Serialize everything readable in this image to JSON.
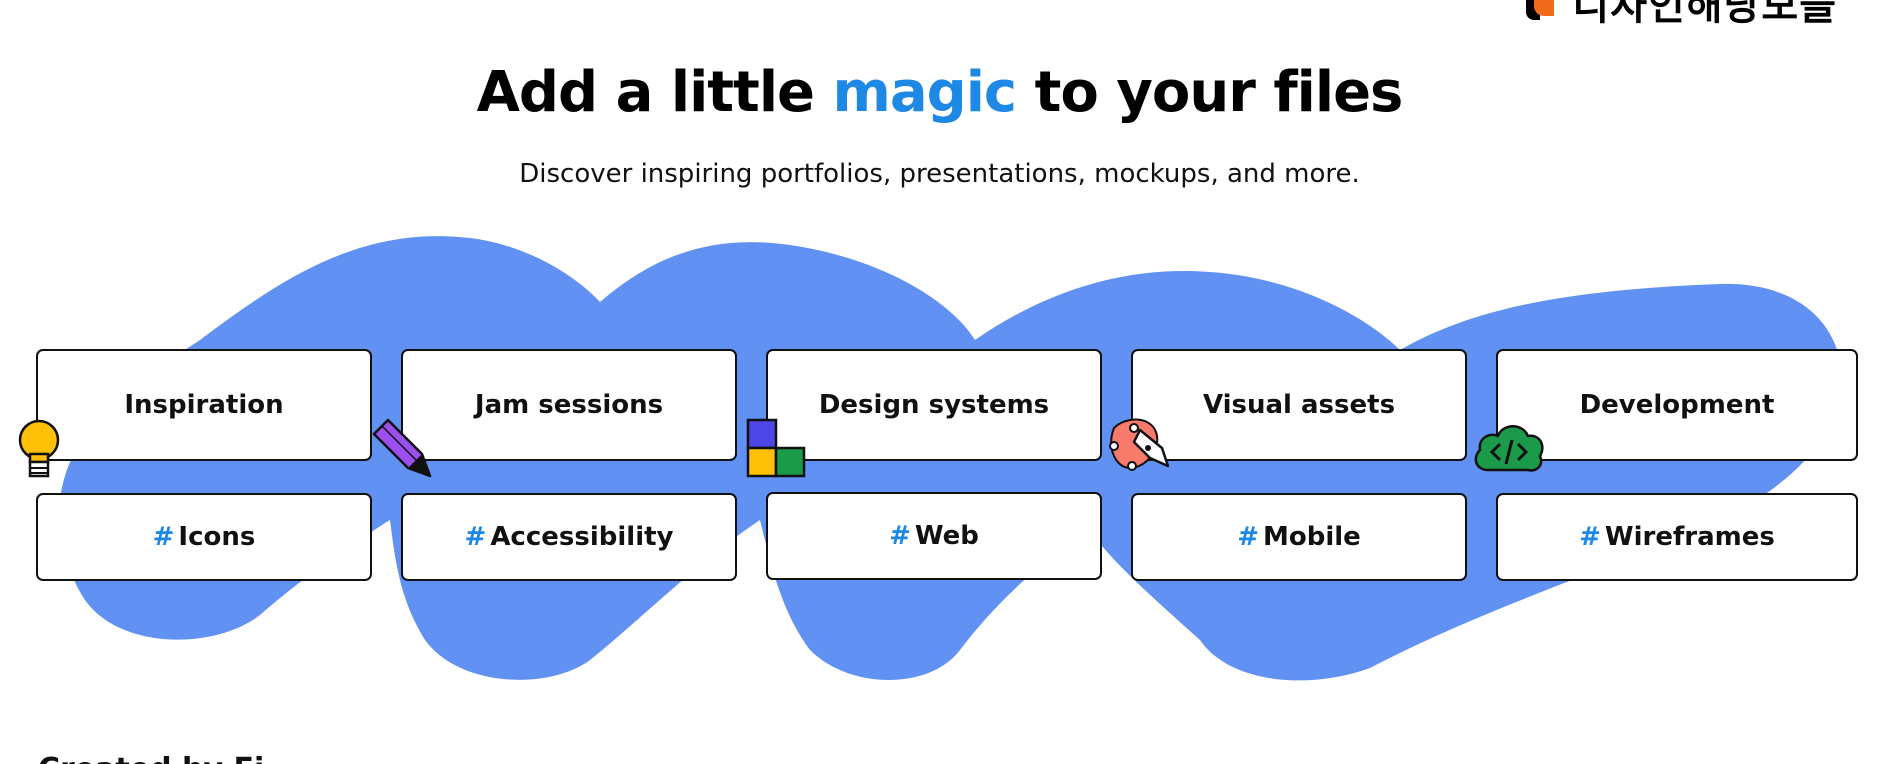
{
  "header": {
    "logo_text": "디자인해당모을",
    "headline_before": "Add a little",
    "headline_accent": "magic",
    "headline_after": "to your files",
    "subheadline": "Discover inspiring portfolios, presentations, mockups, and more."
  },
  "categories": [
    {
      "label": "Inspiration",
      "icon": "lightbulb-icon"
    },
    {
      "label": "Jam sessions",
      "icon": "pencil-icon"
    },
    {
      "label": "Design systems",
      "icon": "blocks-icon"
    },
    {
      "label": "Visual assets",
      "icon": "pen-tool-icon"
    },
    {
      "label": "Development",
      "icon": "code-cloud-icon"
    }
  ],
  "tags": [
    {
      "hash": "#",
      "label": "Icons"
    },
    {
      "hash": "#",
      "label": "Accessibility"
    },
    {
      "hash": "#",
      "label": "Web"
    },
    {
      "hash": "#",
      "label": "Mobile"
    },
    {
      "hash": "#",
      "label": "Wireframes"
    }
  ],
  "footer_peek": "Created by Fi...",
  "colors": {
    "accent": "#1e88e5",
    "blob": "#6191f2",
    "lightbulb": "#ffc107",
    "pencil": "#9c4ff0",
    "block_blue": "#4f46e8",
    "block_yellow": "#ffc107",
    "block_green": "#1b9a4a",
    "pen_tool_bg": "#f77a6b",
    "cloud_green": "#1b9a4a"
  }
}
